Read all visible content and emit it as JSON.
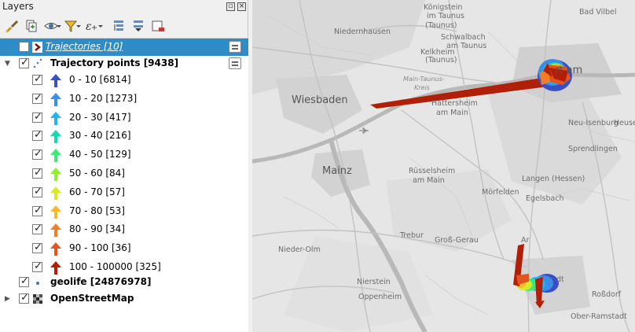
{
  "panel": {
    "title": "Layers",
    "title_buttons": [
      "float-icon",
      "close-icon"
    ]
  },
  "toolbar": {
    "tools": [
      "style-brush-icon",
      "add-group-icon",
      "eye-icon",
      "filter-icon",
      "expression-filter-icon",
      "expand-all-icon",
      "collapse-all-icon",
      "remove-layer-icon"
    ]
  },
  "layers": [
    {
      "label": "Trajectories [10]",
      "checked": false,
      "selected": true,
      "icon": "line-layer-icon"
    },
    {
      "label": "Trajectory points [9438]",
      "checked": true,
      "expanded": true,
      "icon": "point-layer-icon"
    },
    {
      "label": "geolife [24876978]",
      "checked": true,
      "icon": "point-layer-icon"
    },
    {
      "label": "OpenStreetMap",
      "checked": true,
      "icon": "raster-layer-icon"
    }
  ],
  "classes": [
    {
      "label": "0 - 10 [6814]",
      "color": "#3a4fc4",
      "checked": true
    },
    {
      "label": "10 - 20 [1273]",
      "color": "#3a8ee8",
      "checked": true
    },
    {
      "label": "20 - 30 [417]",
      "color": "#1cb8ec",
      "checked": true
    },
    {
      "label": "30 - 40 [216]",
      "color": "#18d8b0",
      "checked": true
    },
    {
      "label": "40 - 50 [129]",
      "color": "#40e87a",
      "checked": true
    },
    {
      "label": "50 - 60 [84]",
      "color": "#92ee34",
      "checked": true
    },
    {
      "label": "60 - 70 [57]",
      "color": "#d6ea28",
      "checked": true
    },
    {
      "label": "70 - 80 [53]",
      "color": "#f6b834",
      "checked": true
    },
    {
      "label": "80 - 90 [34]",
      "color": "#f27e26",
      "checked": true
    },
    {
      "label": "90 - 100 [36]",
      "color": "#e0561e",
      "checked": true
    },
    {
      "label": "100 - 100000 [325]",
      "color": "#b02008",
      "checked": true
    }
  ],
  "map": {
    "places": [
      {
        "name": "Königstein",
        "size": "mid"
      },
      {
        "name": "im Taunus",
        "size": "mid"
      },
      {
        "name": "(Taunus)",
        "size": "mid"
      },
      {
        "name": "Bad Vilbel",
        "size": "mid"
      },
      {
        "name": "Niedernhausen",
        "size": "mid"
      },
      {
        "name": "Schwalbach",
        "size": "mid"
      },
      {
        "name": "am Taunus",
        "size": "mid"
      },
      {
        "name": "Kelkheim",
        "size": "mid"
      },
      {
        "name": "(Taunus)",
        "size": "mid"
      },
      {
        "name": "Main-Taunus-",
        "size": "water"
      },
      {
        "name": "Kreis",
        "size": "water"
      },
      {
        "name": "Wiesbaden",
        "size": "big"
      },
      {
        "name": "Hattersheim",
        "size": "mid"
      },
      {
        "name": "am Main",
        "size": "mid"
      },
      {
        "name": "Neu-Isenburg",
        "size": "mid"
      },
      {
        "name": "Heuse",
        "size": "mid"
      },
      {
        "name": "Sprendlingen",
        "size": "mid"
      },
      {
        "name": "Mainz",
        "size": "big"
      },
      {
        "name": "Rüsselsheim",
        "size": "mid"
      },
      {
        "name": "am Main",
        "size": "mid"
      },
      {
        "name": "Langen (Hessen)",
        "size": "mid"
      },
      {
        "name": "Mörfelden",
        "size": "mid"
      },
      {
        "name": "Egelsbach",
        "size": "mid"
      },
      {
        "name": "Trebur",
        "size": "mid"
      },
      {
        "name": "Groß-Gerau",
        "size": "mid"
      },
      {
        "name": "Nieder-Olm",
        "size": "mid"
      },
      {
        "name": "Nierstein",
        "size": "mid"
      },
      {
        "name": "Oppenheim",
        "size": "mid"
      },
      {
        "name": "Roßdorf",
        "size": "mid"
      },
      {
        "name": "Ober-Ramstadt",
        "size": "mid"
      },
      {
        "name": "dt",
        "size": "mid"
      },
      {
        "name": "rt am",
        "size": "big"
      },
      {
        "name": "Ar",
        "size": "mid"
      }
    ]
  }
}
